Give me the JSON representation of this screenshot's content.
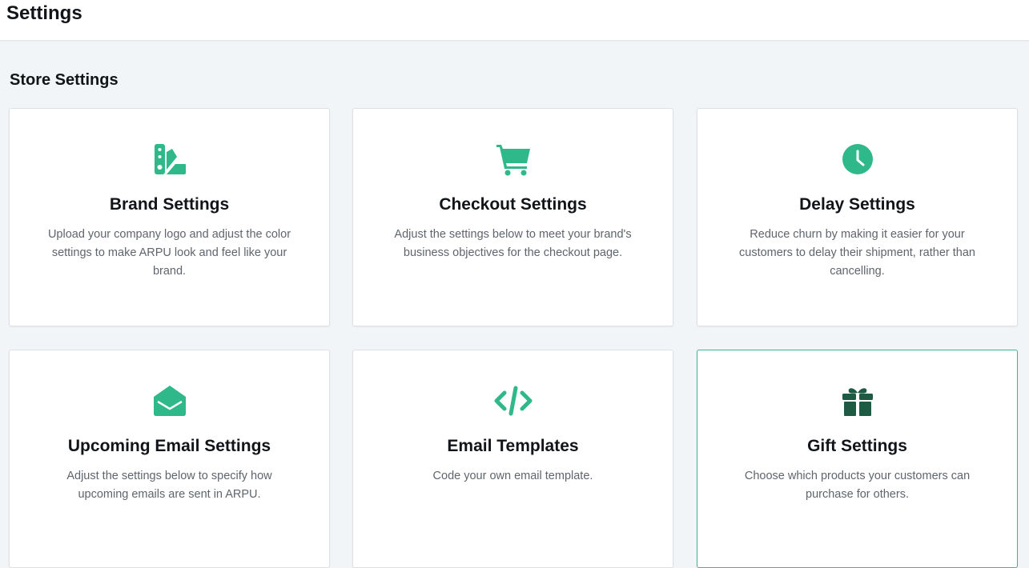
{
  "header": {
    "title": "Settings"
  },
  "section": {
    "title": "Store Settings"
  },
  "colors": {
    "accent": "#2fb889",
    "gift_icon": "#1f5a44",
    "active_border": "#3fb58b"
  },
  "cards": [
    {
      "icon": "palette-swatch-icon",
      "title": "Brand Settings",
      "description": "Upload your company logo and adjust the color settings to make ARPU look and feel like your brand."
    },
    {
      "icon": "shopping-cart-icon",
      "title": "Checkout Settings",
      "description": "Adjust the settings below to meet your brand's business objectives for the checkout page."
    },
    {
      "icon": "clock-icon",
      "title": "Delay Settings",
      "description": "Reduce churn by making it easier for your customers to delay their shipment, rather than cancelling."
    },
    {
      "icon": "envelope-open-icon",
      "title": "Upcoming Email Settings",
      "description": "Adjust the settings below to specify how upcoming emails are sent in ARPU."
    },
    {
      "icon": "code-icon",
      "title": "Email Templates",
      "description": "Code your own email template."
    },
    {
      "icon": "gift-icon",
      "title": "Gift Settings",
      "description": "Choose which products your customers can purchase for others."
    }
  ]
}
